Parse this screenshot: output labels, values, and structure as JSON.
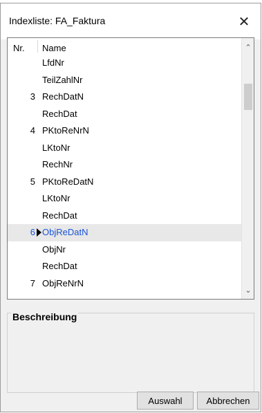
{
  "dialog": {
    "title": "Indexliste: FA_Faktura",
    "close_glyph": "✕"
  },
  "list": {
    "col_nr": "Nr.",
    "col_name": "Name",
    "rows": [
      {
        "nr": "",
        "name": "LfdNr"
      },
      {
        "nr": "",
        "name": "TeilZahlNr"
      },
      {
        "nr": "3",
        "name": "RechDatN"
      },
      {
        "nr": "",
        "name": "RechDat"
      },
      {
        "nr": "4",
        "name": "PKtoReNrN"
      },
      {
        "nr": "",
        "name": "LKtoNr"
      },
      {
        "nr": "",
        "name": "RechNr"
      },
      {
        "nr": "5",
        "name": "PKtoReDatN"
      },
      {
        "nr": "",
        "name": "LKtoNr"
      },
      {
        "nr": "",
        "name": "RechDat"
      },
      {
        "nr": "6",
        "name": "ObjReDatN",
        "selected": true
      },
      {
        "nr": "",
        "name": "ObjNr"
      },
      {
        "nr": "",
        "name": "RechDat"
      },
      {
        "nr": "7",
        "name": "ObjReNrN"
      }
    ],
    "scroll_up_icon": "chevron-up-icon",
    "scroll_down_icon": "chevron-down-icon"
  },
  "description": {
    "title": "Beschreibung",
    "text": ""
  },
  "buttons": {
    "ok": "Auswahl",
    "cancel": "Abbrechen"
  },
  "colors": {
    "selected_text": "#1a53d6",
    "selected_bg": "#e8e8e8"
  }
}
